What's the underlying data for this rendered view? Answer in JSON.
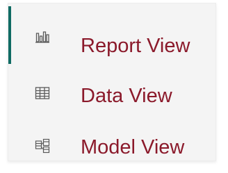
{
  "views": {
    "items": [
      {
        "label": "Report View",
        "icon": "report-view-icon",
        "active": true
      },
      {
        "label": "Data View",
        "icon": "data-view-icon",
        "active": false
      },
      {
        "label": "Model View",
        "icon": "model-view-icon",
        "active": false
      }
    ]
  },
  "colors": {
    "label_text": "#8b1a2b",
    "active_indicator": "#0f6b63",
    "panel_background": "#f4f4f4",
    "icon_stroke": "#5a5a5a"
  }
}
